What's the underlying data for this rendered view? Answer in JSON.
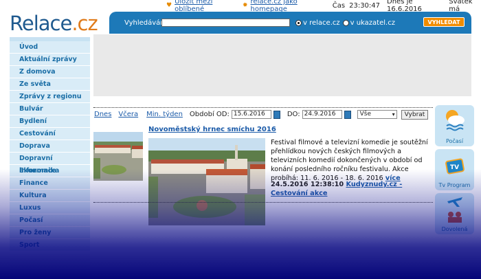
{
  "topbar": {
    "favorite_label": "Uložit mezi oblíbené",
    "homepage_label": "relace.cz jako homepage",
    "time_label": "Čas",
    "time_value": "23:30:47",
    "date_text": "Dnes je 16.6.2016",
    "nameday_text": "Svátek má"
  },
  "logo": {
    "part1": "Relace",
    "part2": ".cz"
  },
  "search": {
    "label": "Vyhledávání",
    "input_value": "",
    "option1": "v relace.cz",
    "option2": "v ukazatel.cz",
    "selected_option": "v relace.cz",
    "button_label": "VYHLEDAT"
  },
  "sidebar": {
    "items": [
      {
        "label": "Úvod"
      },
      {
        "label": "Aktuální zprávy"
      },
      {
        "label": "Z domova"
      },
      {
        "label": "Ze světa"
      },
      {
        "label": "Zprávy z regionu"
      },
      {
        "label": "Bulvár"
      },
      {
        "label": "Bydlení"
      },
      {
        "label": "Cestování"
      },
      {
        "label": "Doprava"
      },
      {
        "label": "Dopravní informace"
      },
      {
        "label": "Ekonomika"
      },
      {
        "label": "Finance"
      },
      {
        "label": "Kultura"
      },
      {
        "label": "Luxus"
      },
      {
        "label": "Počasí"
      },
      {
        "label": "Pro ženy"
      },
      {
        "label": "Sport"
      }
    ]
  },
  "filters": {
    "today": "Dnes",
    "yesterday": "Včera",
    "last_week": "Min. týden",
    "period_from_label": "Období OD:",
    "date_from": "15.6.2016",
    "to_label": "DO:",
    "date_to": "24.9.2016",
    "select_value": "Vše",
    "submit_label": "Vybrat"
  },
  "article": {
    "title": "Novoměstský hrnec smíchu 2016",
    "body": "Festival filmové a televizní komedie je soutěžní přehlídkou nových českých filmových a televizních komedií dokončených v období od konání posledního ročníku festivalu. Akce probíhá: 11. 6. 2016 - 18. 6. 2016",
    "more_label": "více",
    "timestamp": "24.5.2016 12:38:10",
    "source": "Kudyznudy.cz - Cestování akce"
  },
  "right_column": {
    "weather_label": "Počasí",
    "tv_label": "Tv Program",
    "vacation_label": "Dovolená"
  },
  "colors": {
    "brand_blue": "#1d79b8",
    "accent_orange": "#f08c00",
    "link_blue": "#1a5aa8",
    "sidebar_bg": "#d9ecf7"
  },
  "icons": [
    "heart-icon",
    "home-icon",
    "calendar-icon",
    "weather-icon",
    "tv-icon",
    "plane-icon",
    "vacation-icon"
  ]
}
